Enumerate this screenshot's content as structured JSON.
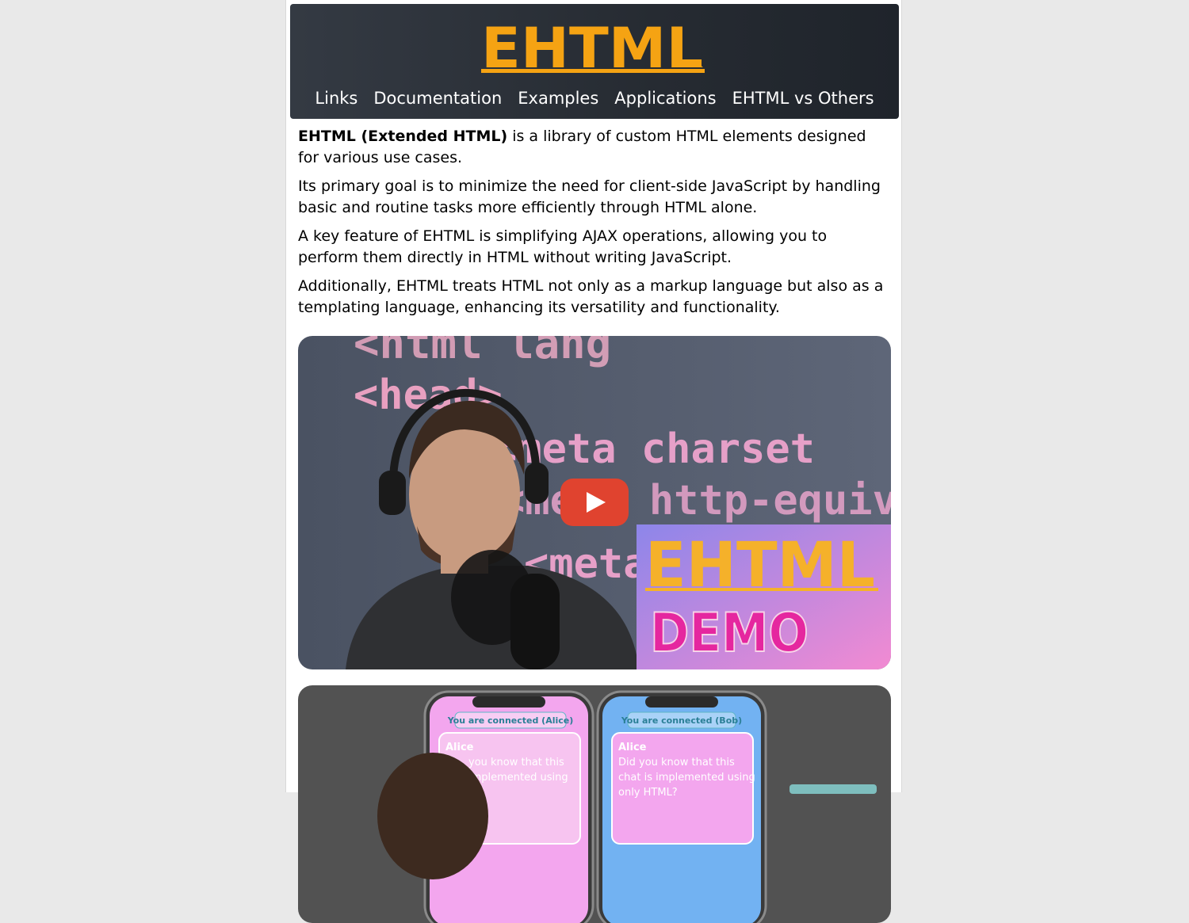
{
  "header": {
    "logo_text": "EHTML",
    "nav": [
      {
        "label": "Links"
      },
      {
        "label": "Documentation"
      },
      {
        "label": "Examples"
      },
      {
        "label": "Applications"
      },
      {
        "label": "EHTML vs Others"
      }
    ]
  },
  "intro": {
    "p1_bold": "EHTML (Extended HTML)",
    "p1_rest": " is a library of custom HTML elements designed for various use cases.",
    "p2": "Its primary goal is to minimize the need for client-side JavaScript by handling basic and routine tasks more efficiently through HTML alone.",
    "p3": "A key feature of EHTML is simplifying AJAX operations, allowing you to perform them directly in HTML without writing JavaScript.",
    "p4": "Additionally, EHTML treats HTML not only as a markup language but also as a templating language, enhancing its versatility and functionality."
  },
  "video1": {
    "code_lines": [
      "<html lang",
      "<head>",
      "<meta charset",
      "<meta http-equiv",
      "<meta"
    ],
    "badge_title": "EHTML",
    "badge_subtitle": "DEMO"
  },
  "video2": {
    "phone_left_status": "You are connected (Alice)",
    "phone_right_status": "You are connected (Bob)",
    "message_author": "Alice",
    "message_text_left_1": "you know that this",
    "message_text_left_2": "implemented using",
    "message_text_right_1": "Did you know that this",
    "message_text_right_2": "chat is implemented using",
    "message_text_right_3": "only HTML?"
  },
  "colors": {
    "logo": "#f5a313",
    "play_button": "#e0432f",
    "demo_pink": "#e5279f",
    "header_bg": "#2c3139"
  }
}
